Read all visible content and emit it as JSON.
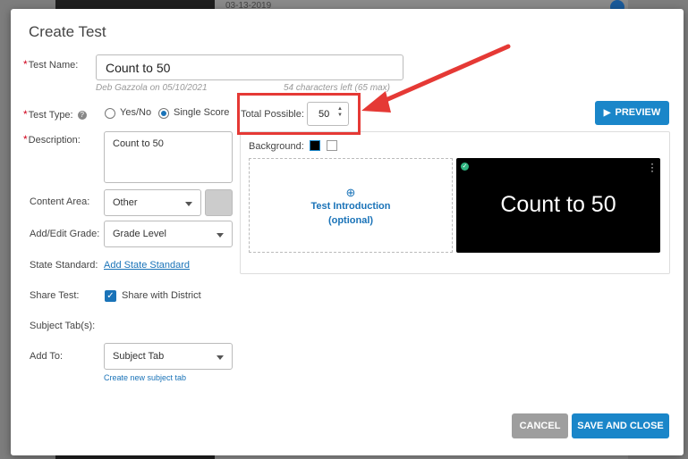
{
  "backdrop": {
    "date_text": "03-13-2019"
  },
  "dialog": {
    "title": "Create Test",
    "test_name": {
      "label": "Test Name:",
      "value": "Count to 50",
      "author_note": "Deb Gazzola on 05/10/2021",
      "chars_left": "54 characters left (65 max)"
    },
    "test_type": {
      "label": "Test Type:",
      "options": [
        "Yes/No",
        "Single Score"
      ],
      "selected": "Single Score"
    },
    "total_possible": {
      "label": "Total Possible:",
      "value": "50"
    },
    "preview_button": "PREVIEW",
    "description": {
      "label": "Description:",
      "value": "Count to 50"
    },
    "background": {
      "label": "Background:"
    },
    "intro_card": {
      "line1": "Test Introduction",
      "line2": "(optional)"
    },
    "slide": {
      "text": "Count to 50"
    },
    "content_area": {
      "label": "Content Area:",
      "value": "Other"
    },
    "grade": {
      "label": "Add/Edit Grade:",
      "value": "Grade Level"
    },
    "state_standard": {
      "label": "State Standard:",
      "link": "Add State Standard"
    },
    "share": {
      "label": "Share Test:",
      "checkbox_label": "Share with District",
      "checked": true
    },
    "subject_tabs": {
      "label": "Subject Tab(s):"
    },
    "add_to": {
      "label": "Add To:",
      "value": "Subject Tab",
      "link": "Create new subject tab"
    },
    "cancel_button": "CANCEL",
    "save_button": "SAVE AND CLOSE"
  },
  "colors": {
    "primary": "#1a86c9",
    "cancel": "#9e9e9e",
    "required": "#d0021b",
    "callout": "#e53935"
  }
}
